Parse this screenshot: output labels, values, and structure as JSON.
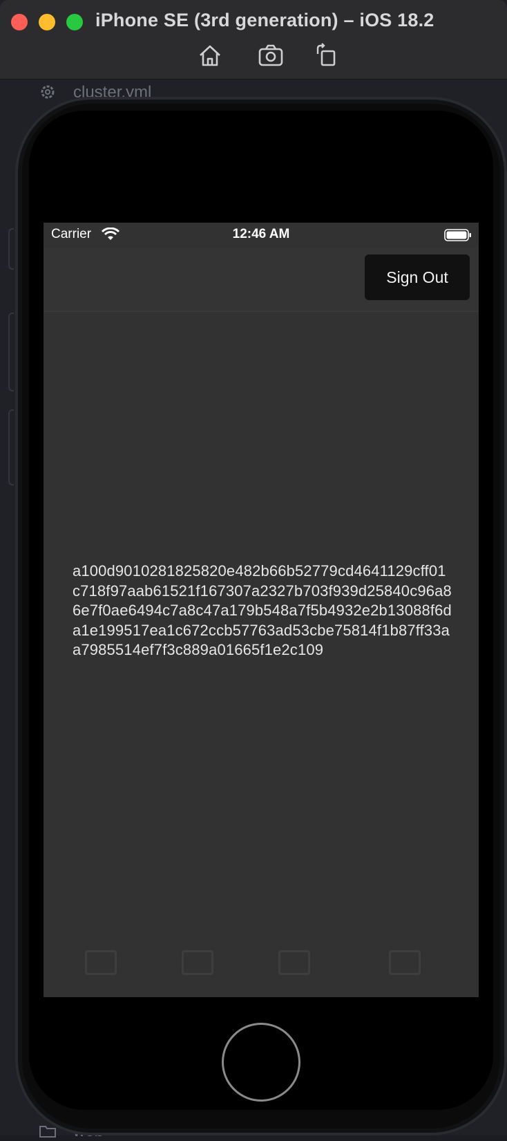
{
  "window": {
    "title": "iPhone SE (3rd generation) – iOS 18.2",
    "toolbar": [
      "home-icon",
      "screenshot-icon",
      "rotate-icon"
    ]
  },
  "background_editor": {
    "top_item": "cluster.yml",
    "bottom_item": "web"
  },
  "status_bar": {
    "carrier": "Carrier",
    "time": "12:46 AM"
  },
  "nav": {
    "sign_out_label": "Sign Out"
  },
  "content": {
    "token": "a100d9010281825820e482b66b52779cd4641129cff01c718f97aab61521f167307a2327b703f939d25840c96a86e7f0ae6494c7a8c47a179b548a7f5b4932e2b13088f6da1e199517ea1c672ccb57763ad53cbe75814f1b87ff33aa7985514ef7f3c889a01665f1e2c109"
  },
  "colors": {
    "screen_bg": "#323232",
    "button_bg": "#111111",
    "traffic_red": "#ff5f57",
    "traffic_yellow": "#febc2e",
    "traffic_green": "#28c840"
  }
}
